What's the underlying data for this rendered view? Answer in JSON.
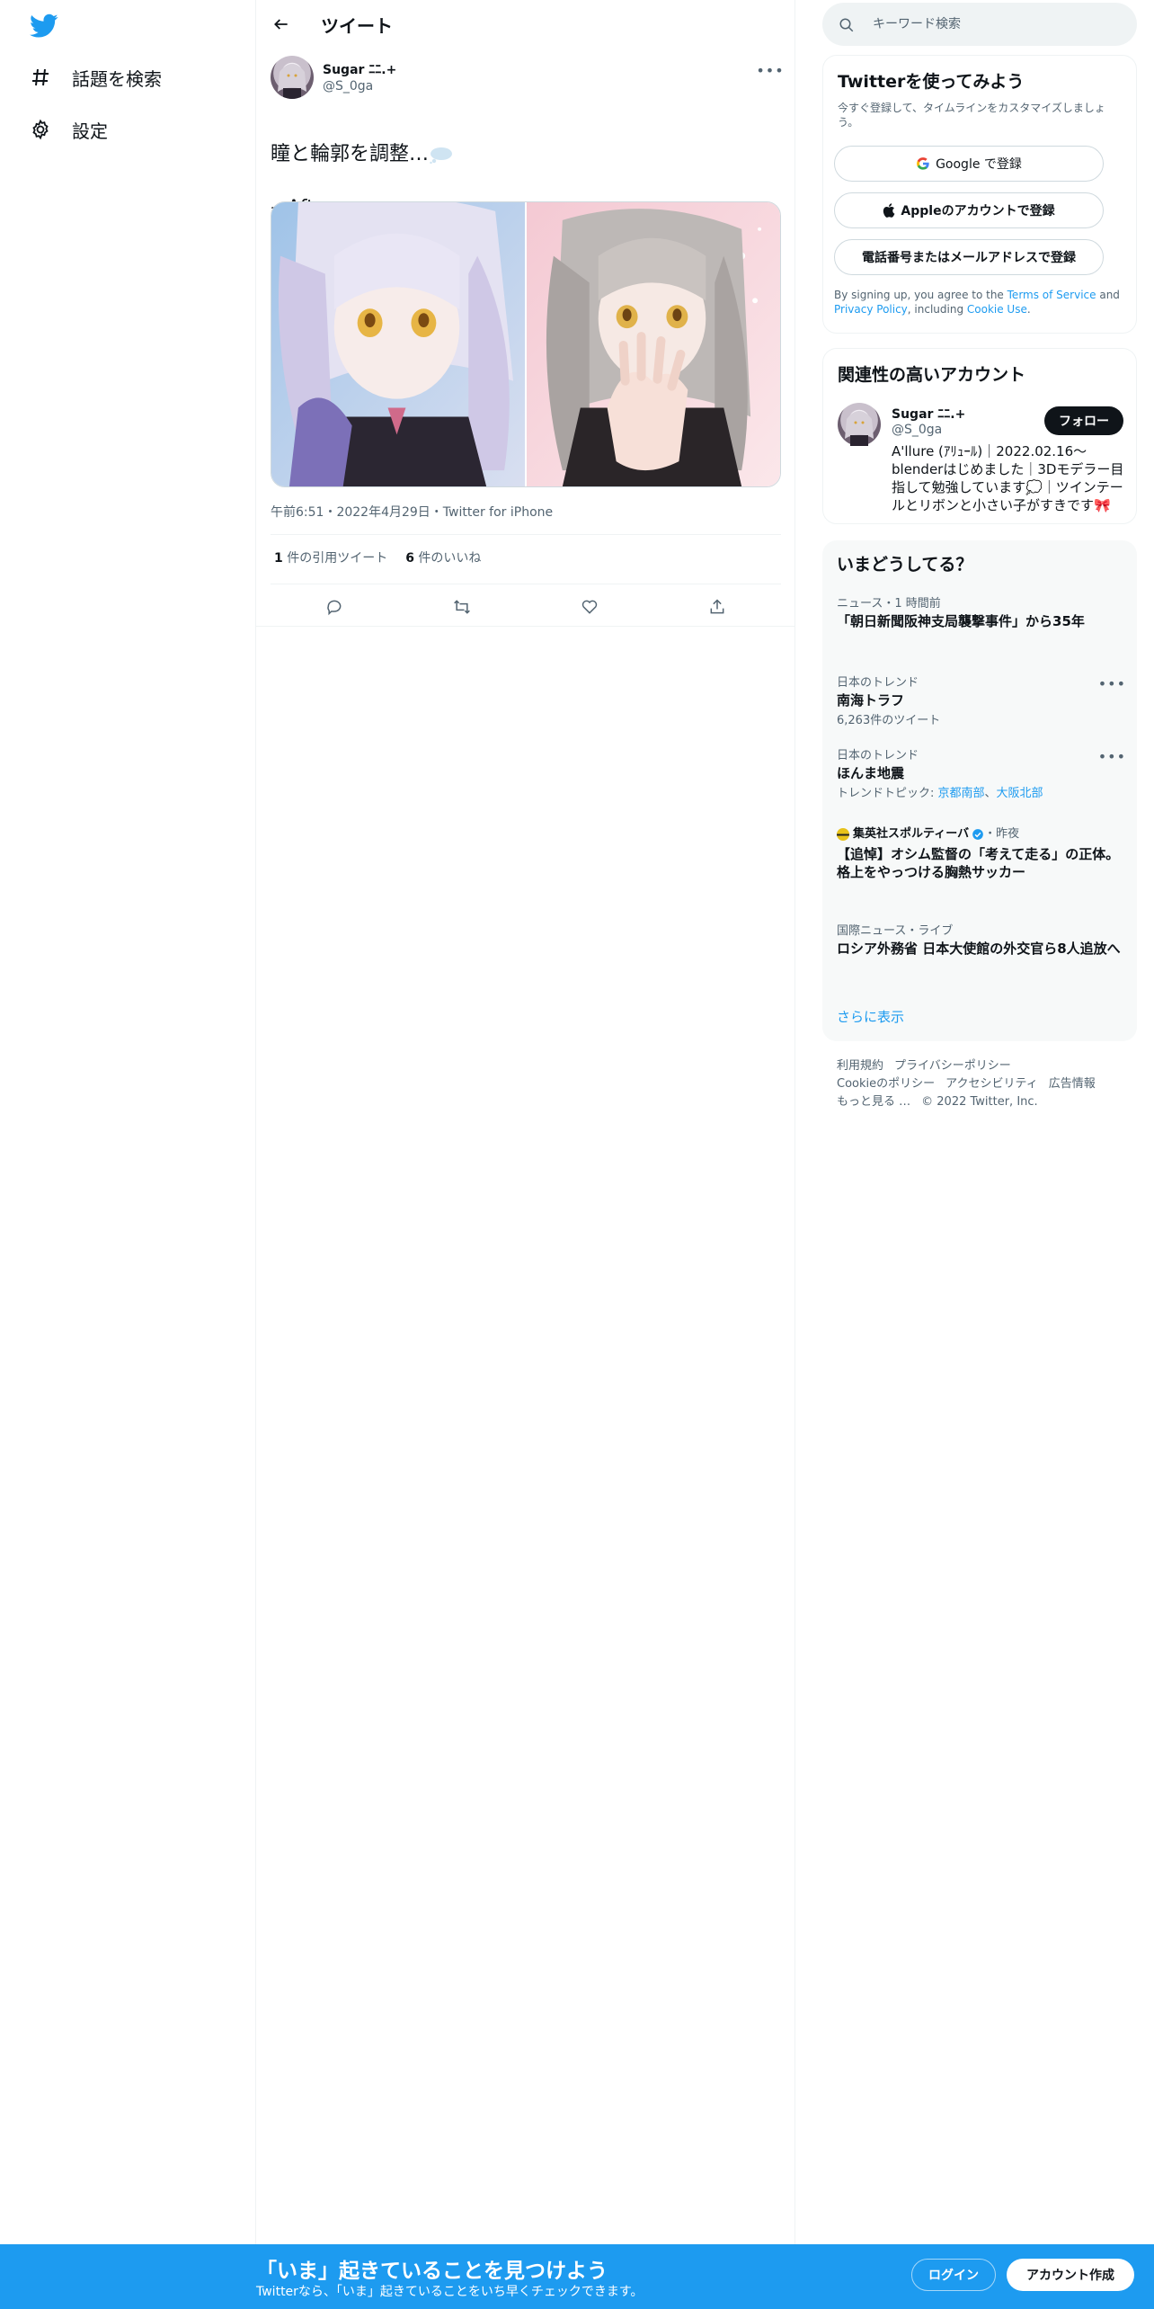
{
  "nav": {
    "items": [
      {
        "label": "話題を検索",
        "icon": "hashtag-icon"
      },
      {
        "label": "設定",
        "icon": "gear-icon"
      }
    ]
  },
  "header": {
    "title": "ツイート"
  },
  "tweet": {
    "author_name": "Sugar ﾆﾆ.+",
    "author_handle": "@S_0ga",
    "text_line1": "瞳と輪郭を調整…",
    "text_line2": "→After",
    "meta": "午前6:51・2022年4月29日・Twitter for iPhone",
    "quote_count": "1",
    "quote_label": "件の引用ツイート",
    "like_count": "6",
    "like_label": "件のいいね"
  },
  "search": {
    "placeholder": "キーワード検索"
  },
  "signup": {
    "title": "Twitterを使ってみよう",
    "subtitle": "今すぐ登録して、タイムラインをカスタマイズしましょう。",
    "google_label": "Google で登録",
    "apple_label": "Appleのアカウントで登録",
    "phone_label": "電話番号またはメールアドレスで登録",
    "terms_prefix": "By signing up, you agree to the ",
    "terms_link": "Terms of Service",
    "terms_and": " and ",
    "privacy_link": "Privacy Policy",
    "terms_including": ", including ",
    "cookie_link": "Cookie Use",
    "terms_end": "."
  },
  "related": {
    "title": "関連性の高いアカウント",
    "name": "Sugar ﾆﾆ.+",
    "handle": "@S_0ga",
    "follow_label": "フォロー",
    "bio": "A'llure (ｱﾘｭｰﾙ)｜2022.02.16〜blenderはじめました｜3Dモデラー目指して勉強しています💭｜ツインテールとリボンと小さい子がすきです🎀"
  },
  "trends": {
    "title": "いまどうしてる？",
    "items": [
      {
        "context": "ニュース・1 時間前",
        "title": "「朝日新聞阪神支局襲撃事件」から35年"
      },
      {
        "context": "日本のトレンド",
        "title": "南海トラフ",
        "count": "6,263件のツイート"
      },
      {
        "context": "日本のトレンド",
        "title": "ほんま地震",
        "topics_label": "トレンドトピック: ",
        "topic1": "京都南部",
        "topic_sep": "、",
        "topic2": "大阪北部"
      },
      {
        "context": "集英社スポルティーバ",
        "time": "・昨夜",
        "title": "【追悼】オシム監督の「考えて走る」の正体。格上をやっつける胸熱サッカー"
      },
      {
        "context": "国際ニュース・ライブ",
        "title": "ロシア外務省 日本大使館の外交官ら8人追放へ"
      }
    ],
    "show_more": "さらに表示"
  },
  "footer": {
    "links": [
      "利用規約",
      "プライバシーポリシー",
      "Cookieのポリシー",
      "アクセシビリティ",
      "広告情報",
      "もっと見る …"
    ],
    "copyright": "© 2022 Twitter, Inc."
  },
  "bottombar": {
    "title": "「いま」起きていることを見つけよう",
    "subtitle": "Twitterなら、「いま」起きていることをいち早くチェックできます。",
    "login_label": "ログイン",
    "signup_label": "アカウント作成"
  },
  "colors": {
    "accent": "#1d9bf0",
    "text": "#0f1419",
    "muted": "#536471"
  }
}
